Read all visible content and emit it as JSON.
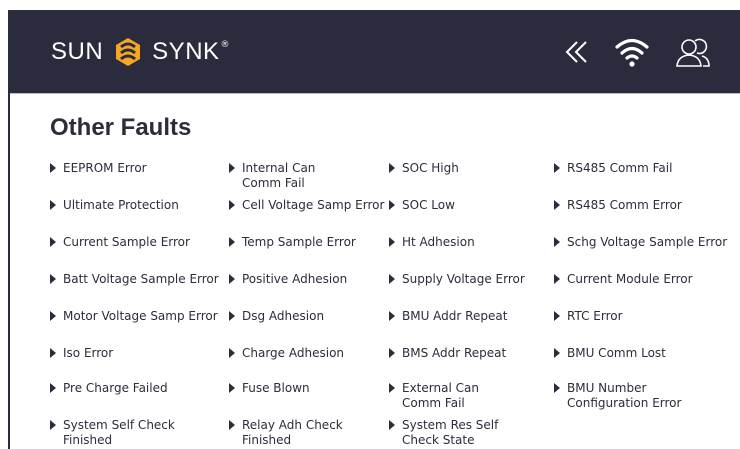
{
  "header": {
    "brand_left": "SUN",
    "brand_right": "SYNK",
    "brand_mark": "®",
    "icons": [
      "back-chevrons-icon",
      "wifi-icon",
      "users-icon"
    ],
    "background_color": "#2a2c3d",
    "accent_color": "#f5a623"
  },
  "page": {
    "title": "Other Faults"
  },
  "faults": [
    [
      "EEPROM Error",
      "Internal Can\nComm Fail",
      "SOC High",
      "RS485 Comm Fail"
    ],
    [
      "Ultimate Protection",
      "Cell Voltage Samp Error",
      "SOC Low",
      "RS485 Comm Error"
    ],
    [
      "Current Sample Error",
      "Temp Sample Error",
      "Ht Adhesion",
      "Schg Voltage Sample Error"
    ],
    [
      "Batt Voltage Sample Error",
      "Positive Adhesion",
      "Supply Voltage Error",
      "Current Module Error"
    ],
    [
      "Motor Voltage Samp Error",
      "Dsg Adhesion",
      "BMU Addr Repeat",
      "RTC Error"
    ],
    [
      "Iso Error",
      "Charge Adhesion",
      "BMS Addr Repeat",
      "BMU Comm Lost"
    ],
    [
      "Pre Charge Failed",
      " Fuse Blown",
      "External Can\nComm Fail",
      "BMU Number\nConfiguration Error"
    ],
    [
      "System Self Check\nFinished",
      "Relay Adh Check\nFinished",
      "System Res Self\nCheck State",
      ""
    ]
  ]
}
